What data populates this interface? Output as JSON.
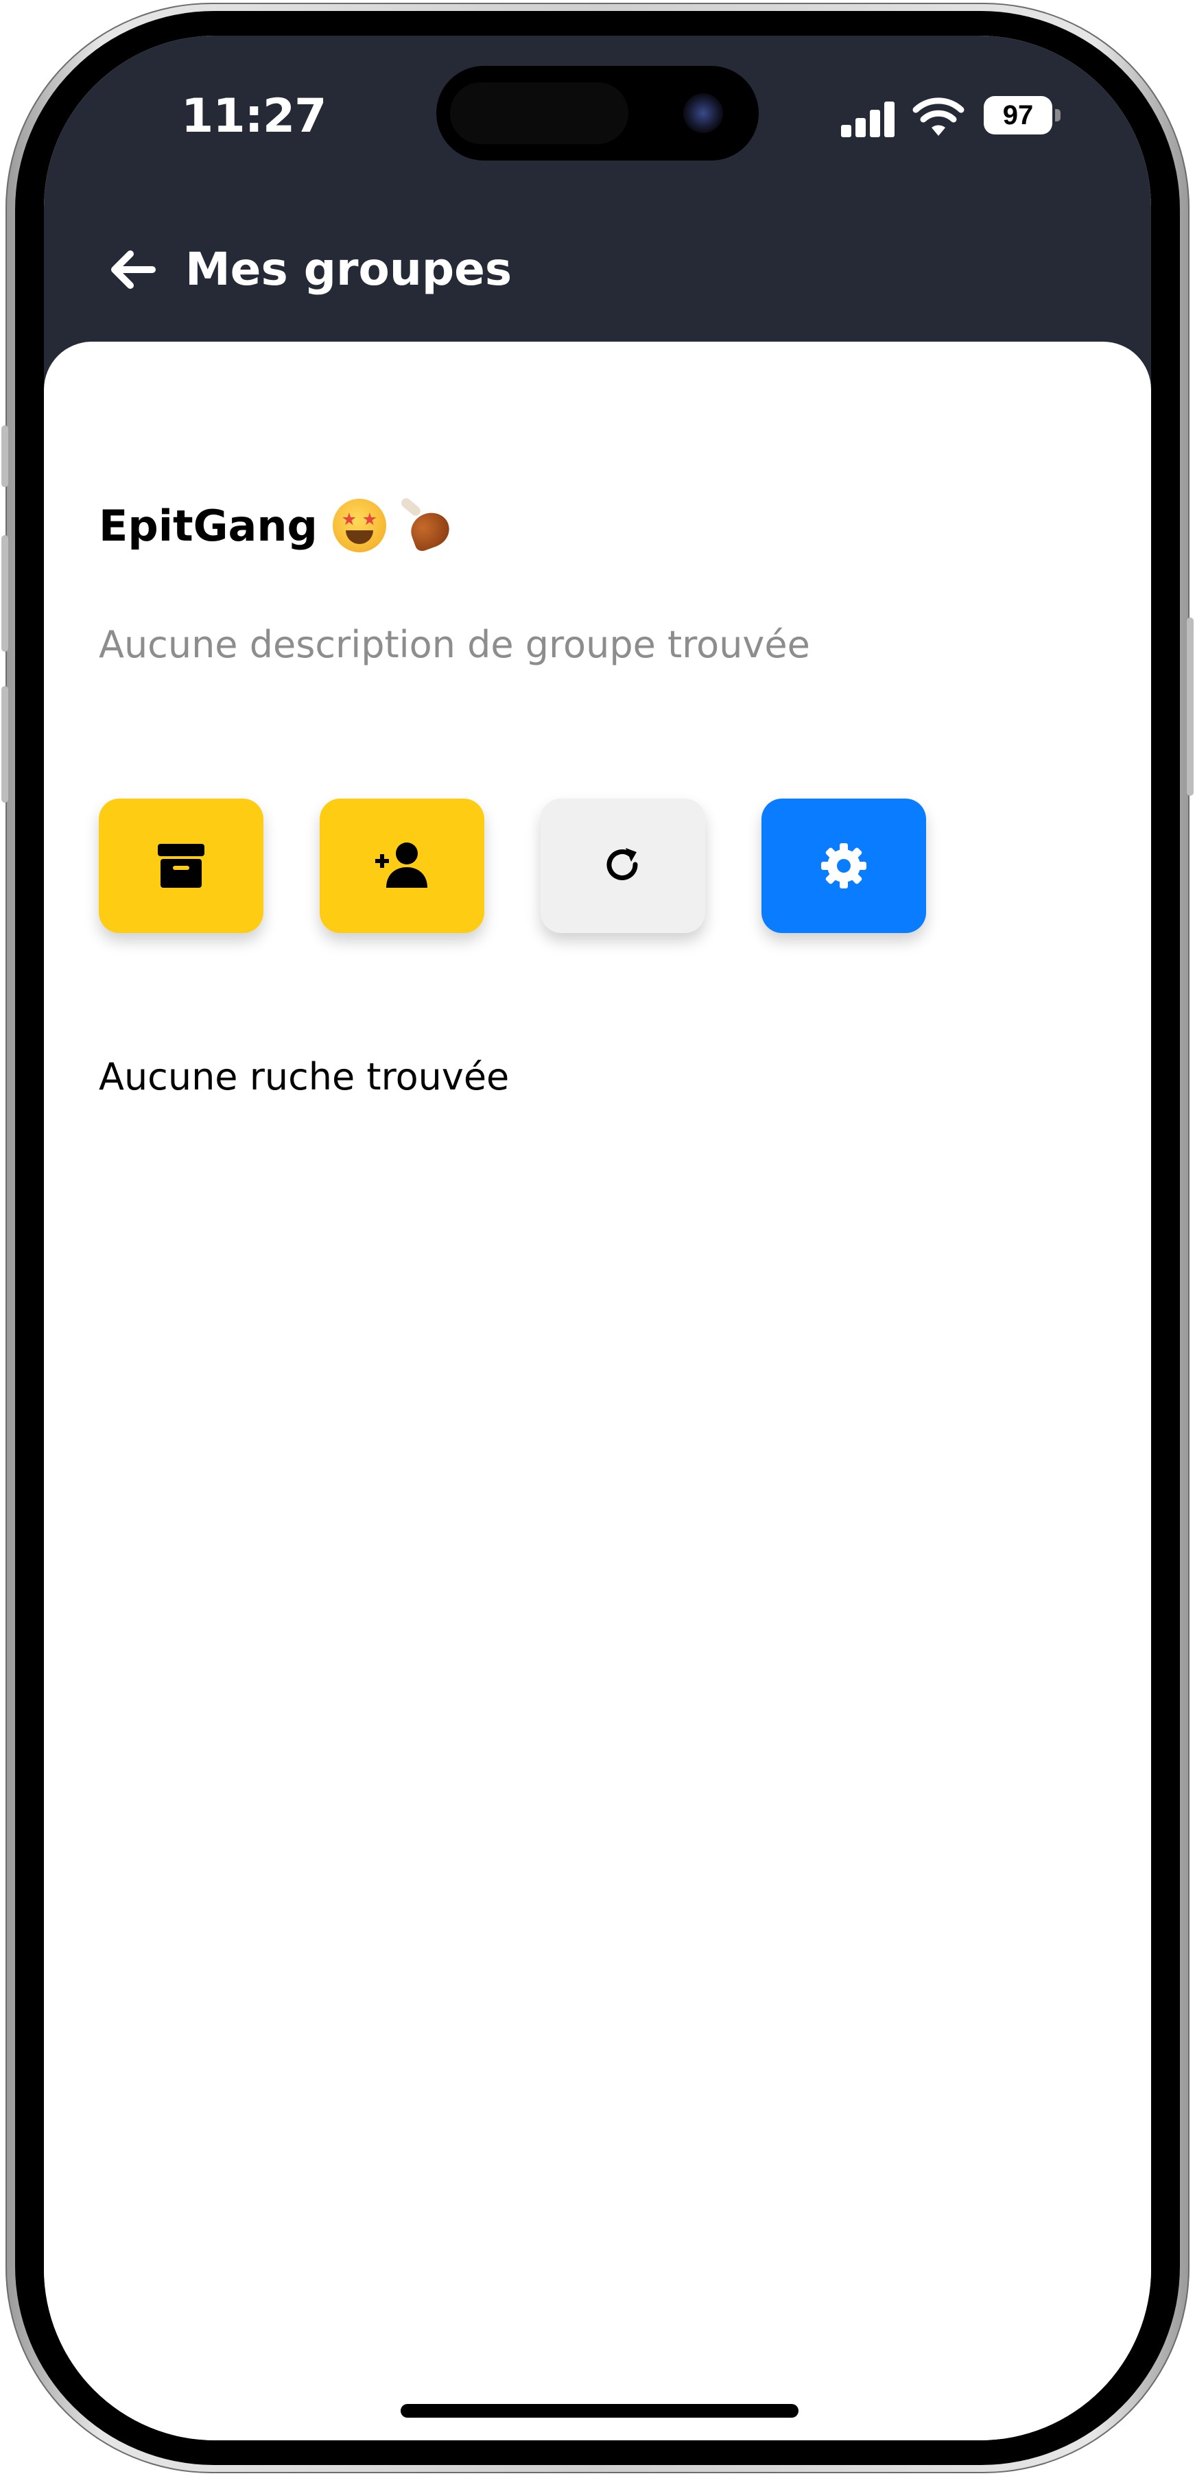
{
  "status_bar": {
    "time": "11:27",
    "battery": "97",
    "icons": [
      "signal-icon",
      "wifi-icon",
      "battery-icon"
    ]
  },
  "header": {
    "back_icon": "arrow-left-icon",
    "title": "Mes groupes",
    "background": "#262a37"
  },
  "group": {
    "name": "EpitGang",
    "emoji_icons": [
      "star-struck-emoji-icon",
      "poultry-leg-emoji-icon"
    ],
    "description": "Aucune description de groupe trouvée"
  },
  "actions": [
    {
      "icon": "archive-icon",
      "color": "#ffcc14"
    },
    {
      "icon": "add-user-icon",
      "color": "#ffcc14"
    },
    {
      "icon": "refresh-icon",
      "color": "#f0f0f0"
    },
    {
      "icon": "gear-icon",
      "color": "#0a7cff"
    }
  ],
  "hives": {
    "empty_message": "Aucune ruche trouvée"
  }
}
